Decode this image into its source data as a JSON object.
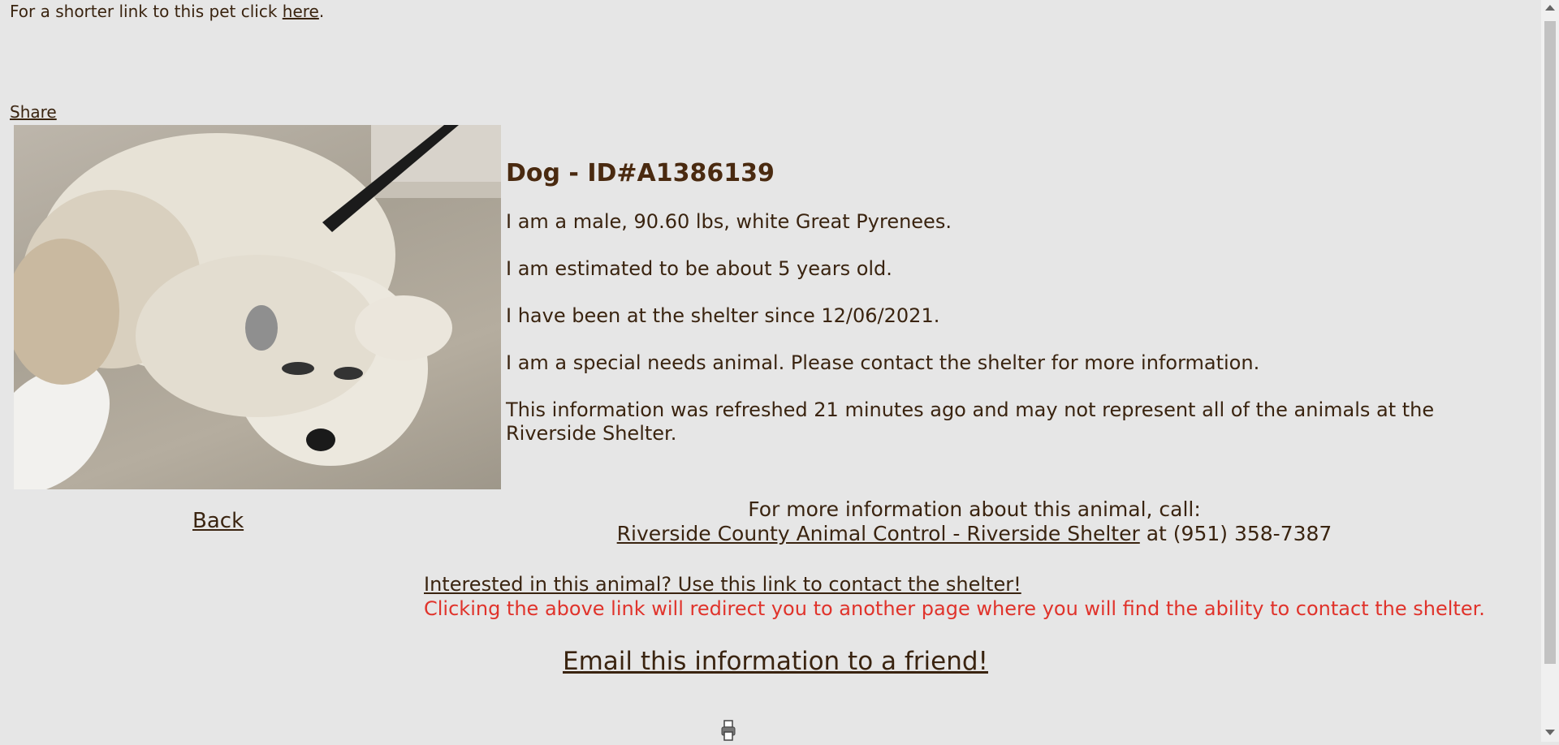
{
  "top": {
    "short_link_prefix": "For a shorter link to this pet click ",
    "short_link_text": "here",
    "short_link_suffix": "."
  },
  "share_label": "Share",
  "animal": {
    "heading": "Dog - ID#A1386139",
    "lines": [
      "I am a male, 90.60 lbs, white Great Pyrenees.",
      "I am estimated to be about 5 years old.",
      "I have been at the shelter since 12/06/2021.",
      "I am a special needs animal. Please contact the shelter for more information.",
      "This information was refreshed 21 minutes ago and may not represent all of the animals at the Riverside Shelter."
    ]
  },
  "back_label": "Back",
  "contact": {
    "intro": "For more information about this animal, call:",
    "shelter_link": "Riverside County Animal Control - Riverside Shelter",
    "phone_text": " at (951) 358-7387"
  },
  "interest": {
    "link": "Interested in this animal? Use this link to contact the shelter!",
    "warning": "Clicking the above link will redirect you to another page where you will find the ability to contact the shelter."
  },
  "email_label": "Email this information to a friend!",
  "colors": {
    "background": "#e6e6e6",
    "text": "#3a2410",
    "warning": "#e0332b"
  },
  "icons": {
    "print": "print-icon"
  }
}
